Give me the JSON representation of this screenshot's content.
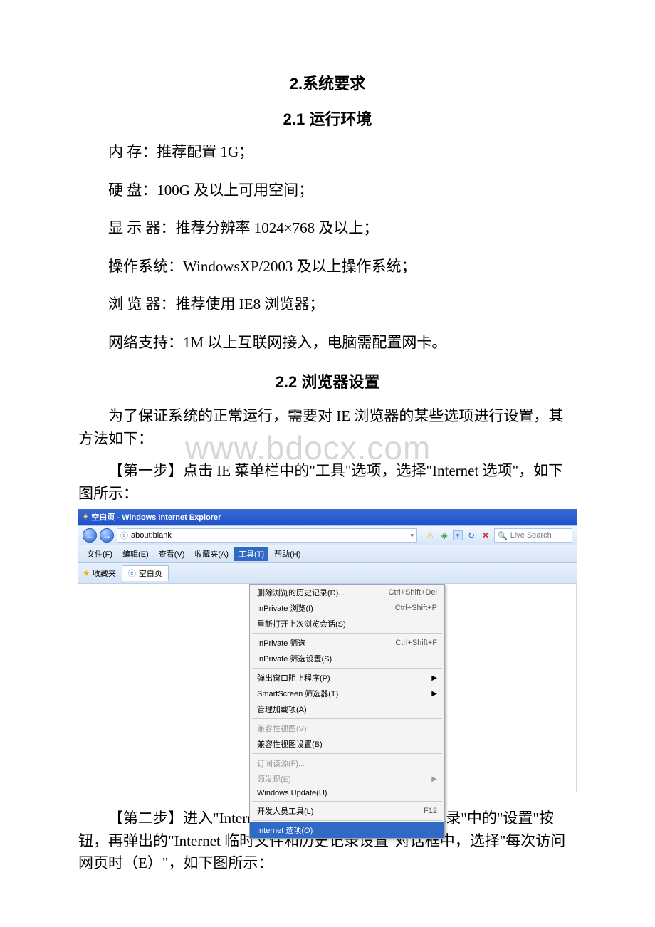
{
  "document": {
    "title_2": "2.系统要求",
    "title_2_1": "2.1 运行环境",
    "specs": {
      "memory": "内 存：推荐配置 1G；",
      "disk": "硬 盘：100G 及以上可用空间；",
      "display": "显 示 器：推荐分辨率 1024×768 及以上；",
      "os": "操作系统：WindowsXP/2003 及以上操作系统；",
      "browser": "浏 览 器：推荐使用 IE8 浏览器；",
      "network": "网络支持：1M 以上互联网接入，电脑需配置网卡。"
    },
    "title_2_2": "2.2 浏览器设置",
    "para_2_2_intro": "为了保证系统的正常运行，需要对 IE 浏览器的某些选项进行设置，其方法如下：",
    "step1": "【第一步】点击 IE 菜单栏中的\"工具\"选项，选择\"Internet 选项\"，如下图所示：",
    "step2": "【第二步】进入\"Internet 选项\"后点击\"浏览器历史记录\"中的\"设置\"按钮，再弹出的\"Internet 临时文件和历史记录设置\"对话框中，选择\"每次访问网页时（E）\"，如下图所示："
  },
  "watermark": "www.bdocx.com",
  "ie": {
    "title": "空白页 - Windows Internet Explorer",
    "address_value": "about:blank",
    "live_search_placeholder": "Live Search",
    "menubar": {
      "file": "文件(F)",
      "edit": "编辑(E)",
      "view": "查看(V)",
      "favorites": "收藏夹(A)",
      "tools": "工具(T)",
      "help": "帮助(H)"
    },
    "favbar": {
      "favorites_label": "收藏夹",
      "tab_label": "空白页"
    },
    "tools_menu": {
      "delete_history": {
        "label": "删除浏览的历史记录(D)...",
        "shortcut": "Ctrl+Shift+Del"
      },
      "inprivate_browse": {
        "label": "InPrivate 浏览(I)",
        "shortcut": "Ctrl+Shift+P"
      },
      "reopen_last": {
        "label": "重新打开上次浏览会话(S)",
        "shortcut": ""
      },
      "inprivate_filter": {
        "label": "InPrivate 筛选",
        "shortcut": "Ctrl+Shift+F"
      },
      "inprivate_filter_settings": {
        "label": "InPrivate 筛选设置(S)",
        "shortcut": ""
      },
      "popup_blocker": {
        "label": "弹出窗口阻止程序(P)",
        "shortcut": ""
      },
      "smartscreen": {
        "label": "SmartScreen 筛选器(T)",
        "shortcut": ""
      },
      "addons": {
        "label": "管理加载项(A)",
        "shortcut": ""
      },
      "compat_view": {
        "label": "兼容性视图(V)",
        "shortcut": ""
      },
      "compat_view_settings": {
        "label": "兼容性视图设置(B)",
        "shortcut": ""
      },
      "subscribe_feed": {
        "label": "订阅该源(F)...",
        "shortcut": ""
      },
      "feed_discovery": {
        "label": "源发现(E)",
        "shortcut": ""
      },
      "windows_update": {
        "label": "Windows Update(U)",
        "shortcut": ""
      },
      "dev_tools": {
        "label": "开发人员工具(L)",
        "shortcut": "F12"
      },
      "internet_options": {
        "label": "Internet 选项(O)",
        "shortcut": ""
      }
    }
  }
}
